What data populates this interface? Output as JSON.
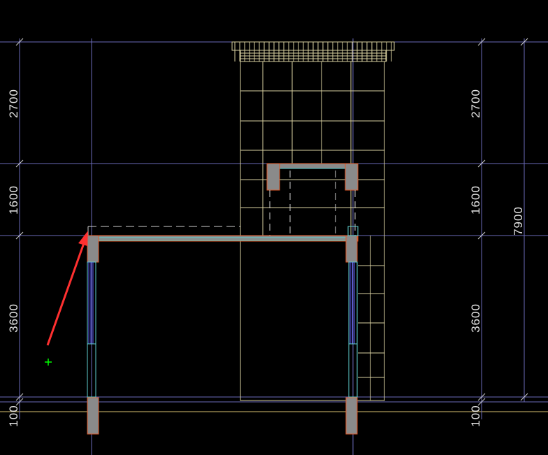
{
  "drawing": {
    "background": "#000000",
    "colors": {
      "grid_line": "#6a6ab8",
      "ground_line": "#d8c070",
      "wall_fill": "#8a8a8a",
      "wall_edge": "#e05a2a",
      "window_line": "#5fd0d0",
      "glass_line": "#6060ff",
      "wall_tile": "#d8d0a0",
      "dim_line": "#b0b0b0",
      "annotation_arrow": "#ff3030",
      "cursor": "#00ff00"
    },
    "dimensions_left": [
      "2700",
      "1600",
      "3600",
      "100"
    ],
    "dimensions_right": [
      "2700",
      "1600",
      "3600",
      "100"
    ],
    "overall_dimension": "7900"
  },
  "annotation": {
    "type": "arrow",
    "color": "#ff3030"
  },
  "cursor": {
    "icon": "crosshair-plus-icon"
  }
}
